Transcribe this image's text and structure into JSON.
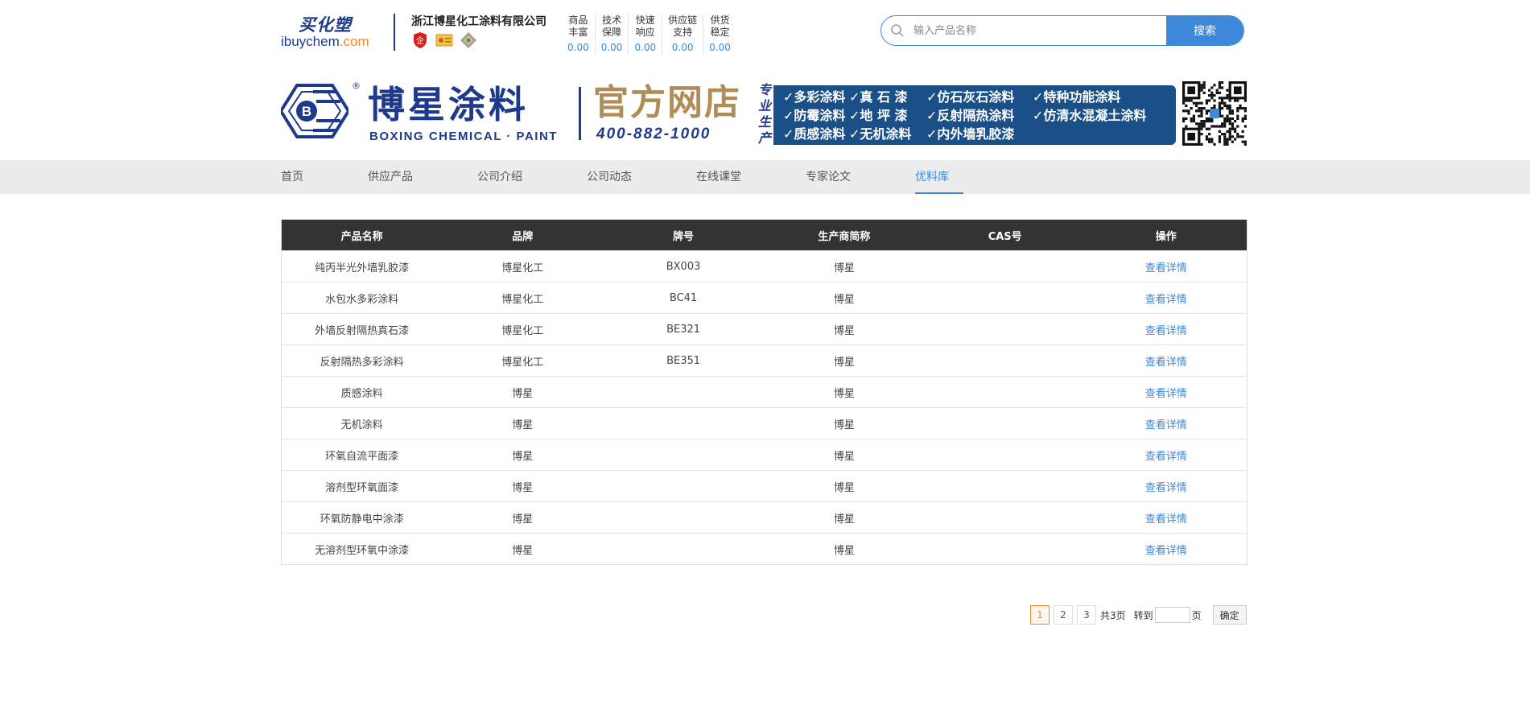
{
  "site": {
    "logo_cn": "买化塑",
    "logo_en_a": "ibuychem",
    "logo_en_b": ".com"
  },
  "company": {
    "name": "浙江博星化工涂料有限公司",
    "badges": [
      "enterprise-badge-icon",
      "certificate-badge-icon",
      "quality-medal-icon"
    ]
  },
  "metrics": [
    {
      "l1": "商品",
      "l2": "丰富",
      "value": "0.00"
    },
    {
      "l1": "技术",
      "l2": "保障",
      "value": "0.00"
    },
    {
      "l1": "快速",
      "l2": "响应",
      "value": "0.00"
    },
    {
      "l1": "供应链",
      "l2": "支持",
      "value": "0.00"
    },
    {
      "l1": "供货",
      "l2": "稳定",
      "value": "0.00"
    }
  ],
  "search": {
    "placeholder": "输入产品名称",
    "button": "搜索"
  },
  "banner": {
    "reg": "®",
    "title": "博星涂料",
    "subtitle": "BOXING CHEMICAL · PAINT",
    "shop": "官方网店",
    "phone": "400-882-1000",
    "vertical": "专业生产",
    "rows": [
      [
        "✓多彩涂料",
        "✓真 石 漆",
        "✓仿石灰石涂料",
        "✓特种功能涂料"
      ],
      [
        "✓防霉涂料",
        "✓地 坪 漆",
        "✓反射隔热涂料",
        "✓仿清水混凝土涂料"
      ],
      [
        "✓质感涂料",
        "✓无机涂料",
        "✓内外墙乳胶漆",
        ""
      ]
    ]
  },
  "nav": {
    "items": [
      "首页",
      "供应产品",
      "公司介绍",
      "公司动态",
      "在线课堂",
      "专家论文",
      "优料库"
    ],
    "active": "优料库"
  },
  "table": {
    "headers": [
      "产品名称",
      "品牌",
      "牌号",
      "生产商简称",
      "CAS号",
      "操作"
    ],
    "rows": [
      [
        "纯丙半光外墙乳胶漆",
        "博星化工",
        "BX003",
        "博星",
        "",
        "查看详情"
      ],
      [
        "水包水多彩涂料",
        "博星化工",
        "BC41",
        "博星",
        "",
        "查看详情"
      ],
      [
        "外墙反射隔热真石漆",
        "博星化工",
        "BE321",
        "博星",
        "",
        "查看详情"
      ],
      [
        "反射隔热多彩涂料",
        "博星化工",
        "BE351",
        "博星",
        "",
        "查看详情"
      ],
      [
        "质感涂料",
        "博星",
        "",
        "博星",
        "",
        "查看详情"
      ],
      [
        "无机涂料",
        "博星",
        "",
        "博星",
        "",
        "查看详情"
      ],
      [
        "环氧自流平面漆",
        "博星",
        "",
        "博星",
        "",
        "查看详情"
      ],
      [
        "溶剂型环氧面漆",
        "博星",
        "",
        "博星",
        "",
        "查看详情"
      ],
      [
        "环氧防静电中涂漆",
        "博星",
        "",
        "博星",
        "",
        "查看详情"
      ],
      [
        "无溶剂型环氧中涂漆",
        "博星",
        "",
        "博星",
        "",
        "查看详情"
      ]
    ]
  },
  "pagination": {
    "pages": [
      "1",
      "2",
      "3"
    ],
    "current": "1",
    "total": "共3页",
    "goto": "转到",
    "unit": "页",
    "confirm": "确定"
  },
  "colors": {
    "accent": "#3d88d8",
    "brand_navy": "#1e3a8a",
    "brand_gold": "#b08d57",
    "active_page": "#f08a2a",
    "table_header": "#333333"
  }
}
